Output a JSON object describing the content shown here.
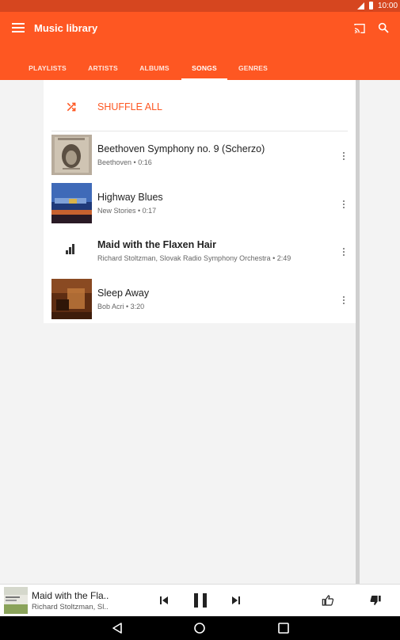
{
  "status": {
    "time": "10:00"
  },
  "appbar": {
    "title": "Music library"
  },
  "tabs": [
    {
      "label": "PLAYLISTS",
      "active": false
    },
    {
      "label": "ARTISTS",
      "active": false
    },
    {
      "label": "ALBUMS",
      "active": false
    },
    {
      "label": "SONGS",
      "active": true
    },
    {
      "label": "GENRES",
      "active": false
    }
  ],
  "shuffle": {
    "label": "SHUFFLE ALL"
  },
  "songs": [
    {
      "title": "Beethoven Symphony no. 9 (Scherzo)",
      "subtitle": "Beethoven • 0:16"
    },
    {
      "title": "Highway Blues",
      "subtitle": "New Stories • 0:17"
    },
    {
      "title": "Maid with the Flaxen Hair",
      "subtitle": "Richard Stoltzman, Slovak Radio Symphony Orchestra • 2:49",
      "now_playing": true
    },
    {
      "title": "Sleep Away",
      "subtitle": "Bob Acri • 3:20"
    }
  ],
  "player": {
    "title": "Maid with the Fla..",
    "artist": "Richard Stoltzman, Sl.."
  },
  "colors": {
    "accent": "#fe5722",
    "status_bar": "#d6461f"
  },
  "icons": [
    "menu-icon",
    "cast-icon",
    "search-icon",
    "shuffle-icon",
    "more-vert-icon",
    "equalizer-icon",
    "skip-previous-icon",
    "pause-icon",
    "skip-next-icon",
    "thumb-up-icon",
    "thumb-down-icon",
    "back-icon",
    "home-icon",
    "recents-icon"
  ]
}
